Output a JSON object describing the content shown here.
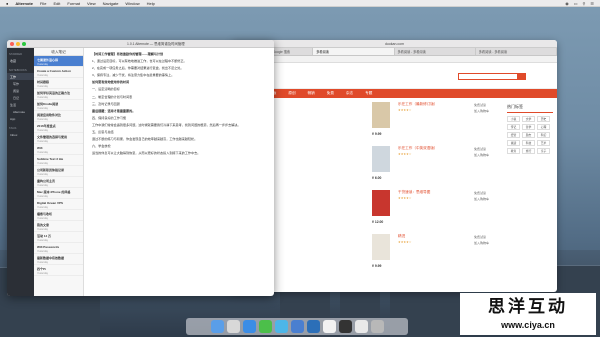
{
  "menubar": {
    "apple": "",
    "app_name": "Alternote",
    "menus": [
      "File",
      "Edit",
      "Format",
      "View",
      "Navigate",
      "Window",
      "Help"
    ]
  },
  "browser": {
    "window_title": "duokan.com",
    "tabs": [
      "多看阅读 - 多看阅读官网 - Google 搜索",
      "多看阅读",
      "多看阅读 - 多看阅读",
      "多看阅读 - 多看阅读"
    ],
    "site_name": "阅读",
    "nav": [
      "首页",
      "出版",
      "原创",
      "畅销",
      "免费",
      "杂志",
      "专题"
    ],
    "books": [
      {
        "title": "乐在工作（最新修订版）",
        "price": "¥ 9.99"
      },
      {
        "title": "乐在工作（中英双语版）",
        "price": "¥ 6.00"
      },
      {
        "title": "干货速读：思维导图",
        "price": "¥ 12.00"
      },
      {
        "title": "精进",
        "price": "¥ 9.99"
      }
    ],
    "book_actions": [
      "免费试读",
      "加入购物车"
    ],
    "hot_title": "热门标签",
    "tags": [
      "小说",
      "文学",
      "历史",
      "传记",
      "哲学",
      "心理",
      "经管",
      "励志",
      "科幻",
      "悬疑",
      "科技",
      "艺术",
      "教育",
      "旅行",
      "亲子"
    ]
  },
  "alternote": {
    "window_title": "1.0.1 Alternote — 思维简谱及时间管理",
    "sidebar": {
      "items": [
        {
          "label": "STARRED",
          "section": true
        },
        {
          "label": "收藏"
        },
        {
          "label": "NOTEBOOKS",
          "section": true
        },
        {
          "label": "工作",
          "selected": true
        },
        {
          "label": "写作",
          "sub": true
        },
        {
          "label": "阅读",
          "sub": true
        },
        {
          "label": "日记",
          "sub": true
        },
        {
          "label": "生活"
        },
        {
          "label": "Alternote",
          "sub": true
        },
        {
          "label": "App"
        },
        {
          "label": "TAGS",
          "section": true
        },
        {
          "label": "Inbox"
        }
      ]
    },
    "list": {
      "header": "收入笔记",
      "notes": [
        {
          "title": "七周读外语心得",
          "preview": "Yesterday",
          "selected": true
        },
        {
          "title": "Create a Custom Action",
          "preview": "Yesterday"
        },
        {
          "title": "时间跟踪",
          "preview": "Yesterday"
        },
        {
          "title": "如何学好英语的正确方法",
          "preview": "Yesterday"
        },
        {
          "title": "如何Kindle阅读",
          "preview": "Yesterday"
        },
        {
          "title": "阅读应用软件对比",
          "preview": "Yesterday"
        },
        {
          "title": "2016年度盘点",
          "preview": "Yesterday"
        },
        {
          "title": "文件管理的选择与使用",
          "preview": "Yesterday"
        },
        {
          "title": "Wifi",
          "preview": "Yesterday"
        },
        {
          "title": "Sublime Text 3 Ide",
          "preview": "Yesterday"
        },
        {
          "title": "公司新职员体验记录",
          "preview": "Yesterday"
        },
        {
          "title": "重构公司主页",
          "preview": "Yesterday"
        },
        {
          "title": "Mac 版本 iPhone 的风格",
          "preview": "Yesterday"
        },
        {
          "title": "Digital Ocean VPS",
          "preview": "Yesterday"
        },
        {
          "title": "播客与收听",
          "preview": "Yesterday"
        },
        {
          "title": "我的文章",
          "preview": "Yesterday"
        },
        {
          "title": "活动 14 万",
          "preview": "Yesterday"
        },
        {
          "title": "Wifi Passwords",
          "preview": "Yesterday"
        },
        {
          "title": "最新数据中有效数据",
          "preview": "Yesterday"
        },
        {
          "title": "四个Pi",
          "preview": "Yesterday"
        }
      ]
    },
    "editor": {
      "paragraphs": [
        {
          "text": "【时间工作管理】有效激励你的管理——理解与计划",
          "heading": true
        },
        {
          "text": "1、通过设定目标，可以有效地推进工作，也可以在过程中不断修正。"
        },
        {
          "text": "2、在完成一项任务之后，你需要对结果进行复盘，找出不足之处。"
        },
        {
          "text": "3、保持专注，减少干扰，将注意力集中在最重要的事情上。"
        },
        {
          "text": "如何更有效地使用你的时间",
          "heading": true
        },
        {
          "text": "一、设定清晰的目标"
        },
        {
          "text": "二、制定合理的计划与时间表"
        },
        {
          "text": "三、及时记录与回顾"
        },
        {
          "text": "最后提醒：坚持才是最重要的。",
          "heading": true
        },
        {
          "text": "四、保持良好的工作习惯"
        },
        {
          "text": "工作中我们常常会遇到很多问题，这时候就需要我们冷静下来思考，找到问题的根源，然后再一步步去解决。"
        },
        {
          "text": "五、反思与总结"
        },
        {
          "text": "通过不断的练习与积累，你会发现自己的效率越来越高，工作也越来越轻松。"
        },
        {
          "text": "六、学会放松"
        },
        {
          "text": "适当的休息可以让大脑得到恢复，从而以更好的状态投入到接下来的工作中去。"
        }
      ]
    }
  },
  "watermark": {
    "chinese": "思洋互动",
    "url": "www.ciya.cn"
  },
  "colors": {
    "accent": "#e04a2a",
    "sidebar_bg": "#2b2f36",
    "selected_note": "#4a7fd0"
  }
}
